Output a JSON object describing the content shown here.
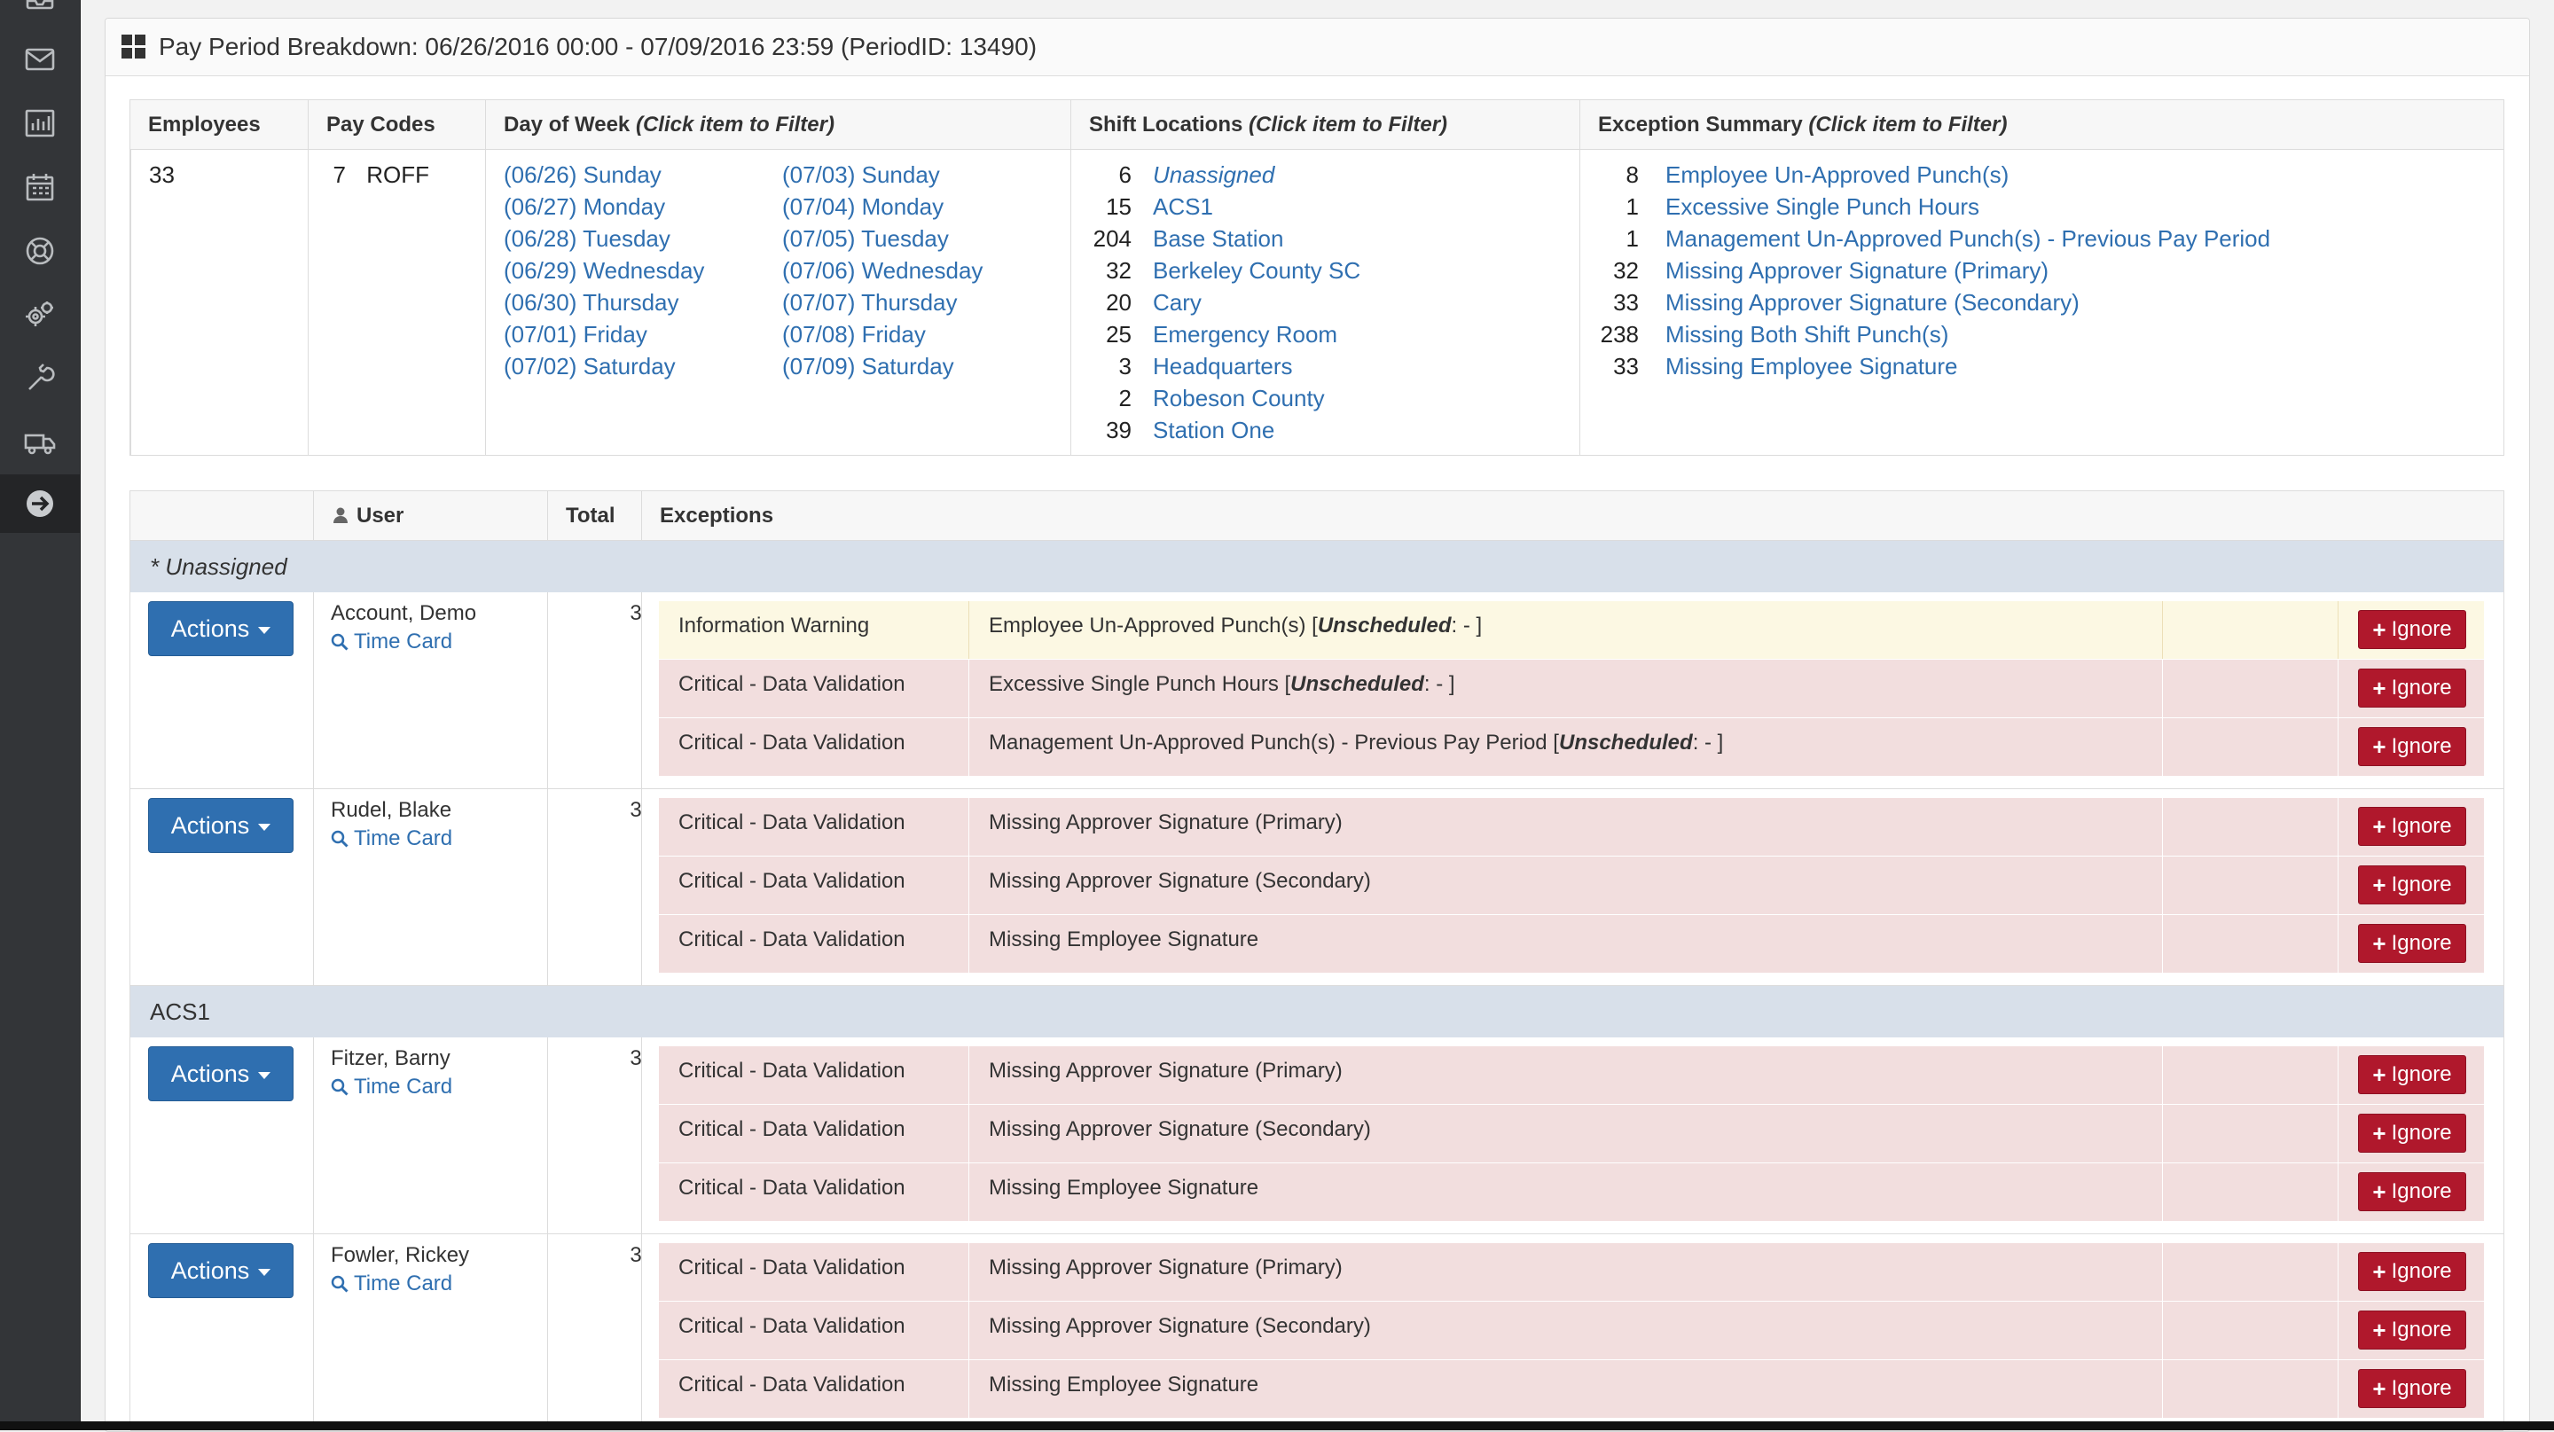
{
  "sidebar": {
    "icons": [
      "inbox-icon",
      "mail-icon",
      "bar-chart-icon",
      "calendar-icon",
      "support-icon",
      "gears-icon",
      "wrench-icon",
      "truck-icon",
      "arrow-right-circle-icon"
    ]
  },
  "panel": {
    "title": "Pay Period Breakdown: 06/26/2016 00:00 - 07/09/2016 23:59 (PeriodID: 13490)"
  },
  "summary": {
    "headers": {
      "employees": "Employees",
      "pay_codes": "Pay Codes",
      "day_of_week": "Day of Week",
      "shift_locations": "Shift Locations",
      "exception_summary": "Exception Summary",
      "filter_hint": "(Click item to Filter)"
    },
    "employees_count": "33",
    "pay_code": {
      "count": "7",
      "code": "ROFF"
    },
    "days_col1": [
      "(06/26) Sunday",
      "(06/27) Monday",
      "(06/28) Tuesday",
      "(06/29) Wednesday",
      "(06/30) Thursday",
      "(07/01) Friday",
      "(07/02) Saturday"
    ],
    "days_col2": [
      "(07/03) Sunday",
      "(07/04) Monday",
      "(07/05) Tuesday",
      "(07/06) Wednesday",
      "(07/07) Thursday",
      "(07/08) Friday",
      "(07/09) Saturday"
    ],
    "locations": [
      {
        "count": "6",
        "name": "Unassigned"
      },
      {
        "count": "15",
        "name": "ACS1"
      },
      {
        "count": "204",
        "name": "Base Station"
      },
      {
        "count": "32",
        "name": "Berkeley County SC"
      },
      {
        "count": "20",
        "name": "Cary"
      },
      {
        "count": "25",
        "name": "Emergency Room"
      },
      {
        "count": "3",
        "name": "Headquarters"
      },
      {
        "count": "2",
        "name": "Robeson County"
      },
      {
        "count": "39",
        "name": "Station One"
      }
    ],
    "exceptions": [
      {
        "count": "8",
        "name": "Employee Un-Approved Punch(s)"
      },
      {
        "count": "1",
        "name": "Excessive Single Punch Hours"
      },
      {
        "count": "1",
        "name": "Management Un-Approved Punch(s) - Previous Pay Period"
      },
      {
        "count": "32",
        "name": "Missing Approver Signature (Primary)"
      },
      {
        "count": "33",
        "name": "Missing Approver Signature (Secondary)"
      },
      {
        "count": "238",
        "name": "Missing Both Shift Punch(s)"
      },
      {
        "count": "33",
        "name": "Missing Employee Signature"
      }
    ]
  },
  "main": {
    "headers": {
      "user": "User",
      "total": "Total",
      "exceptions": "Exceptions"
    },
    "actions_label": "Actions",
    "timecard_label": "Time Card",
    "ignore_label": "Ignore",
    "groups": [
      {
        "name": "* Unassigned",
        "employees": [
          {
            "name": "Account, Demo",
            "total": "3",
            "exceptions": [
              {
                "severity": "Information Warning",
                "desc": "Employee Un-Approved Punch(s) [",
                "bold": "Unscheduled",
                "tail": ": - ]",
                "warn": true
              },
              {
                "severity": "Critical - Data Validation",
                "desc": "Excessive Single Punch Hours [",
                "bold": "Unscheduled",
                "tail": ": - ]"
              },
              {
                "severity": "Critical - Data Validation",
                "desc": "Management Un-Approved Punch(s) - Previous Pay Period [",
                "bold": "Unscheduled",
                "tail": ": - ]"
              }
            ]
          },
          {
            "name": "Rudel, Blake",
            "total": "3",
            "exceptions": [
              {
                "severity": "Critical - Data Validation",
                "desc": "Missing Approver Signature (Primary)"
              },
              {
                "severity": "Critical - Data Validation",
                "desc": "Missing Approver Signature (Secondary)"
              },
              {
                "severity": "Critical - Data Validation",
                "desc": "Missing Employee Signature"
              }
            ]
          }
        ]
      },
      {
        "name": "ACS1",
        "employees": [
          {
            "name": "Fitzer, Barny",
            "total": "3",
            "exceptions": [
              {
                "severity": "Critical - Data Validation",
                "desc": "Missing Approver Signature (Primary)"
              },
              {
                "severity": "Critical - Data Validation",
                "desc": "Missing Approver Signature (Secondary)"
              },
              {
                "severity": "Critical - Data Validation",
                "desc": "Missing Employee Signature"
              }
            ]
          },
          {
            "name": "Fowler, Rickey",
            "total": "3",
            "exceptions": [
              {
                "severity": "Critical - Data Validation",
                "desc": "Missing Approver Signature (Primary)"
              },
              {
                "severity": "Critical - Data Validation",
                "desc": "Missing Approver Signature (Secondary)"
              },
              {
                "severity": "Critical - Data Validation",
                "desc": "Missing Employee Signature"
              }
            ]
          }
        ]
      }
    ]
  },
  "colors": {
    "link": "#2f6fb0",
    "primary_button": "#2f6fb0",
    "danger_button": "#b0182c",
    "critical_row": "#f2dede",
    "warning_row": "#fcf8e3",
    "group_row": "#d8e0ea",
    "sidebar": "#333538"
  }
}
